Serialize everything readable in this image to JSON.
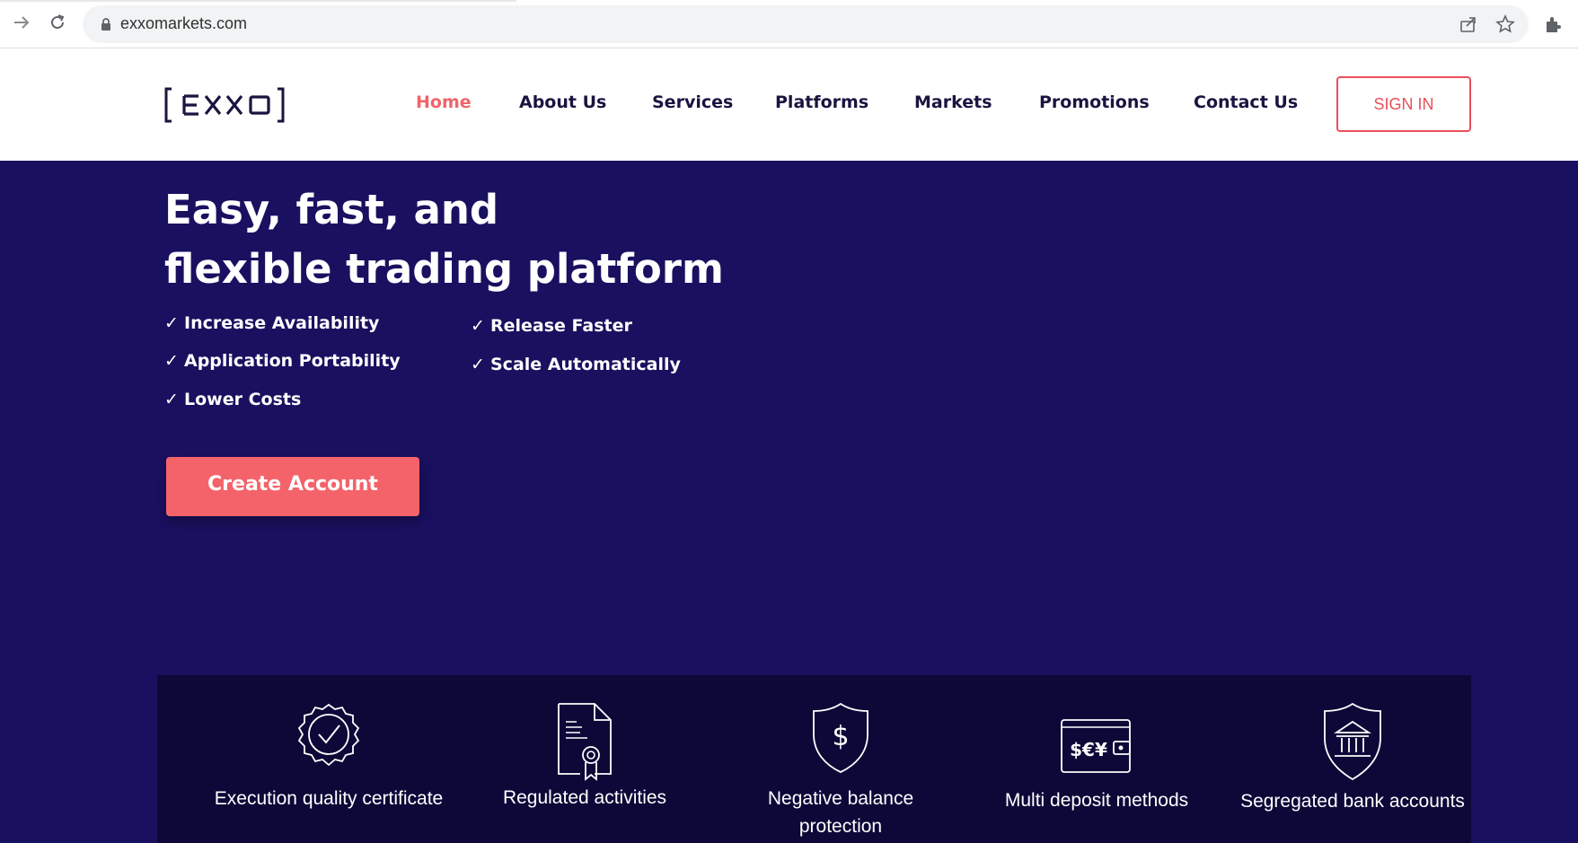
{
  "browser": {
    "url": "exxomarkets.com",
    "icons": [
      "forward-icon",
      "reload-icon",
      "lock-icon",
      "share-icon",
      "star-icon",
      "extensions-icon"
    ]
  },
  "header": {
    "logo_text": "[EXXO]",
    "nav": [
      {
        "label": "Home",
        "active": true
      },
      {
        "label": "About Us",
        "active": false
      },
      {
        "label": "Services",
        "active": false
      },
      {
        "label": "Platforms",
        "active": false
      },
      {
        "label": "Markets",
        "active": false
      },
      {
        "label": "Promotions",
        "active": false
      },
      {
        "label": "Contact Us",
        "active": false
      }
    ],
    "signin_label": "SIGN IN"
  },
  "hero": {
    "title_line1": "Easy, fast, and",
    "title_line2": "flexible trading platform",
    "checklist_left": [
      "Increase Availability",
      "Application Portability",
      "Lower Costs"
    ],
    "checklist_right": [
      "Release Faster",
      "Scale Automatically"
    ],
    "cta_label": "Create Account"
  },
  "features": [
    {
      "icon": "certificate-badge-icon",
      "label_line1": "Execution quality certificate",
      "label_line2": ""
    },
    {
      "icon": "regulated-document-icon",
      "label_line1": "Regulated activities",
      "label_line2": ""
    },
    {
      "icon": "dollar-shield-icon",
      "label_line1": "Negative balance",
      "label_line2": "protection"
    },
    {
      "icon": "wallet-currency-icon",
      "label_line1": "Multi deposit methods",
      "label_line2": ""
    },
    {
      "icon": "bank-shield-icon",
      "label_line1": "Segregated bank accounts",
      "label_line2": ""
    }
  ],
  "colors": {
    "brand_navy": "#1b1440",
    "hero_bg": "#1a1060",
    "features_bg": "#0d0838",
    "accent": "#f5636a"
  }
}
